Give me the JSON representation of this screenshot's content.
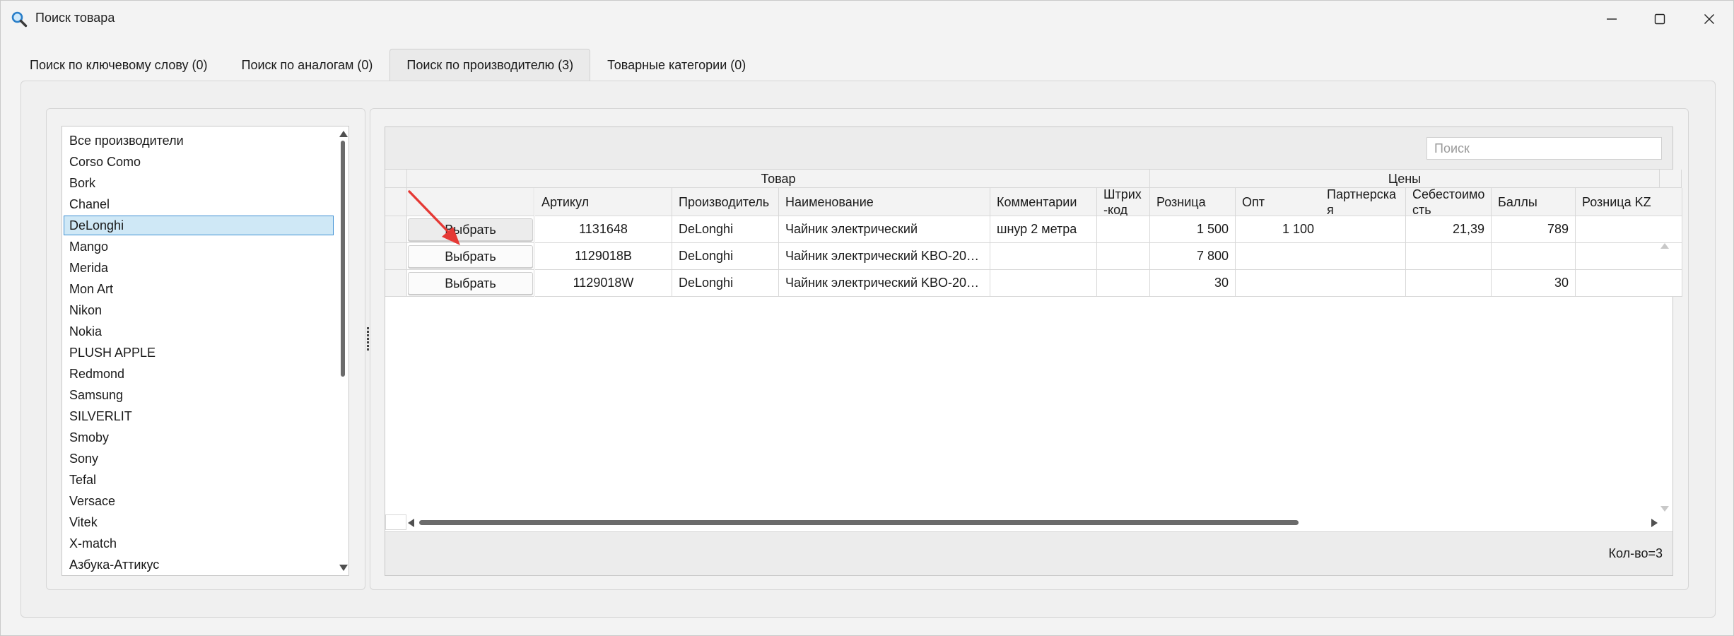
{
  "window": {
    "title": "Поиск товара",
    "icon": "magnifier-icon"
  },
  "tabs": [
    {
      "label": "Поиск по ключевому слову (0)",
      "active": false
    },
    {
      "label": "Поиск по аналогам (0)",
      "active": false
    },
    {
      "label": "Поиск по производителю (3)",
      "active": true
    },
    {
      "label": "Товарные категории (0)",
      "active": false
    }
  ],
  "manufacturers": {
    "selected": "DeLonghi",
    "items": [
      "Все производители",
      "Corso Como",
      "Bork",
      "Chanel",
      "DeLonghi",
      "Mango",
      "Merida",
      "Mon Art",
      "Nikon",
      "Nokia",
      "PLUSH APPLE",
      "Redmond",
      "Samsung",
      "SILVERLIT",
      "Smoby",
      "Sony",
      "Tefal",
      "Versace",
      "Vitek",
      "X-match",
      "Азбука-Аттикус"
    ]
  },
  "grid": {
    "search_placeholder": "Поиск",
    "group_headers": {
      "product": "Товар",
      "prices": "Цены"
    },
    "columns": {
      "article": "Артикул",
      "manufacturer": "Производитель",
      "name": "Наименование",
      "comment": "Комментарии",
      "barcode": "Штрих\n-код",
      "retail": "Розница",
      "wholesale": "Опт",
      "partner": "Партнерска\nя",
      "cost": "Себестоимо\nсть",
      "points": "Баллы",
      "retail_kz": "Розница KZ"
    },
    "select_label": "Выбрать",
    "rows": [
      {
        "article": "1131648",
        "manufacturer": "DeLonghi",
        "name": "Чайник электрический",
        "comment": "шнур 2 метра",
        "barcode": "",
        "retail": "1 500",
        "wholesale": "1 100",
        "partner": "",
        "cost": "21,39",
        "points": "789",
        "retail_kz": ""
      },
      {
        "article": "1129018B",
        "manufacturer": "DeLonghi",
        "name": "Чайник электрический KBO-200...",
        "comment": "",
        "barcode": "",
        "retail": "7 800",
        "wholesale": "",
        "partner": "",
        "cost": "",
        "points": "",
        "retail_kz": ""
      },
      {
        "article": "1129018W",
        "manufacturer": "DeLonghi",
        "name": "Чайник электрический KBO-200...",
        "comment": "",
        "barcode": "",
        "retail": "30",
        "wholesale": "",
        "partner": "",
        "cost": "",
        "points": "30",
        "retail_kz": ""
      }
    ],
    "count_label": "Кол-во=3"
  },
  "colors": {
    "selection_bg": "#cfe8f6",
    "selection_border": "#3c8fd3",
    "annotation_arrow": "#e53935"
  }
}
